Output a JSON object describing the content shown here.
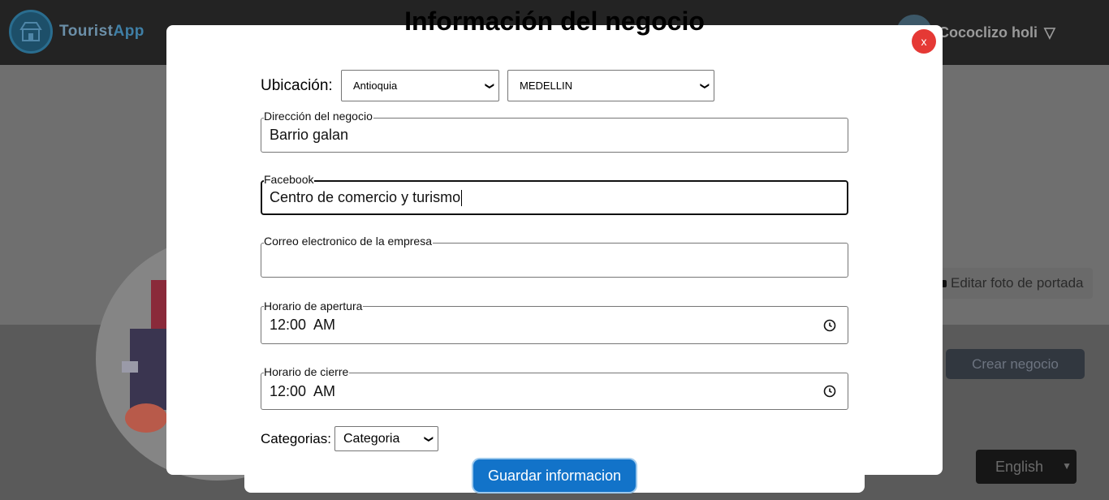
{
  "app": {
    "logo_text_main": "Tourist",
    "logo_text_accent": "App",
    "user_name": "Cococlizo holi",
    "user_menu_chevron": "▽"
  },
  "background": {
    "edit_cover_label": "Editar foto de portada",
    "create_business_label": "Crear negocio",
    "language_value": "English"
  },
  "modal": {
    "title": "Información del negocio",
    "close_label": "x",
    "location": {
      "label": "Ubicación:",
      "department_value": "Antioquia",
      "city_value": "MEDELLIN"
    },
    "fields": {
      "address": {
        "legend": "Dirección del negocio",
        "value": "Barrio galan"
      },
      "facebook": {
        "legend": "Facebook",
        "value": "Centro de comercio y turismo"
      },
      "email": {
        "legend": "Correo electronico de la empresa",
        "value": ""
      },
      "opening": {
        "legend": "Horario de apertura",
        "value": "12:00  AM"
      },
      "closing": {
        "legend": "Horario de cierre",
        "value": "12:00  AM"
      }
    },
    "category": {
      "label": "Categorias:",
      "value": "Categoria"
    },
    "save_label": "Guardar informacion"
  },
  "colors": {
    "close_button": "#e53935",
    "save_button": "#1273c9",
    "overlay_topbar": "#232323"
  },
  "icons": {
    "select_chevron": "chevron-down-icon",
    "time_picker": "clock-icon",
    "camera": "camera-icon"
  }
}
